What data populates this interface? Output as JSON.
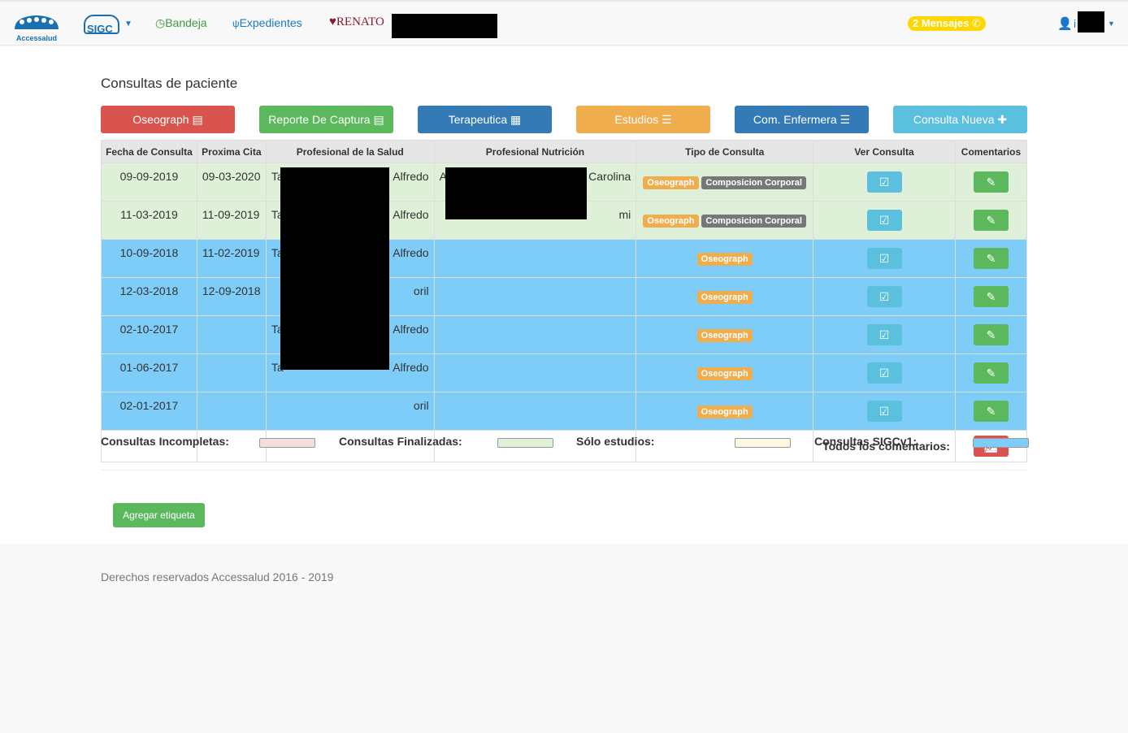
{
  "nav": {
    "logo": "Accessalud",
    "sigc": "SIGC",
    "bandeja": "Bandeja",
    "expedientes": "Expedientes",
    "patient": "RENATO",
    "messages": "2 Mensajes",
    "user_initial": "i"
  },
  "page_title": "Consultas de paciente",
  "buttons": {
    "oseograph": "Oseograph",
    "reporte": "Reporte De Captura",
    "terapeutica": "Terapeutica",
    "estudios": "Estudios",
    "enfermera": "Com. Enfermera",
    "nueva": "Consulta Nueva"
  },
  "colors": {
    "danger": "#d9534f",
    "success": "#5cb85c",
    "primary": "#337ab7",
    "warning": "#f0ad4e",
    "info": "#5bc0de",
    "finalizada": "#dff0d8",
    "sigcv1": "#7ecdf9"
  },
  "table": {
    "headers": [
      "Fecha de Consulta",
      "Proxima Cita",
      "Profesional de la Salud",
      "Profesional Nutrición",
      "Tipo de Consulta",
      "Ver Consulta",
      "Comentarios"
    ],
    "rows": [
      {
        "fecha": "09-09-2019",
        "proxima": "09-03-2020",
        "salud_a": "Ta",
        "salud_b": "Alfredo",
        "nutr_a": "A",
        "nutr_b": "Carolina",
        "tipo": [
          "Oseograph",
          "Composicion Corporal"
        ],
        "status": "fin"
      },
      {
        "fecha": "11-03-2019",
        "proxima": "11-09-2019",
        "salud_a": "Ta",
        "salud_b": "Alfredo",
        "nutr_a": "",
        "nutr_b": "mi",
        "tipo": [
          "Oseograph",
          "Composicion Corporal"
        ],
        "status": "fin"
      },
      {
        "fecha": "10-09-2018",
        "proxima": "11-02-2019",
        "salud_a": "Ta",
        "salud_b": "Alfredo",
        "nutr_a": "",
        "nutr_b": "",
        "tipo": [
          "Oseograph"
        ],
        "status": "sigc"
      },
      {
        "fecha": "12-03-2018",
        "proxima": "12-09-2018",
        "salud_a": "",
        "salud_b": "oril",
        "nutr_a": "",
        "nutr_b": "",
        "tipo": [
          "Oseograph"
        ],
        "status": "sigc"
      },
      {
        "fecha": "02-10-2017",
        "proxima": "",
        "salud_a": "Ta",
        "salud_b": "Alfredo",
        "nutr_a": "",
        "nutr_b": "",
        "tipo": [
          "Oseograph"
        ],
        "status": "sigc"
      },
      {
        "fecha": "01-06-2017",
        "proxima": "",
        "salud_a": "Ta",
        "salud_b": "Alfredo",
        "nutr_a": "",
        "nutr_b": "",
        "tipo": [
          "Oseograph"
        ],
        "status": "sigc"
      },
      {
        "fecha": "02-01-2017",
        "proxima": "",
        "salud_a": "",
        "salud_b": "oril",
        "nutr_a": "",
        "nutr_b": "",
        "tipo": [
          "Oseograph"
        ],
        "status": "sigc"
      }
    ],
    "todos_comentarios": "Todos los comentarios:"
  },
  "legend": {
    "incompletas": "Consultas Incompletas:",
    "finalizadas": "Consultas Finalizadas:",
    "estudios": "Sólo estudios:",
    "sigcv1": "Consultas SIGCv1:"
  },
  "agregar_etiqueta": "Agregar etiqueta",
  "footer": "Derechos reservados Accessalud 2016 - 2019"
}
